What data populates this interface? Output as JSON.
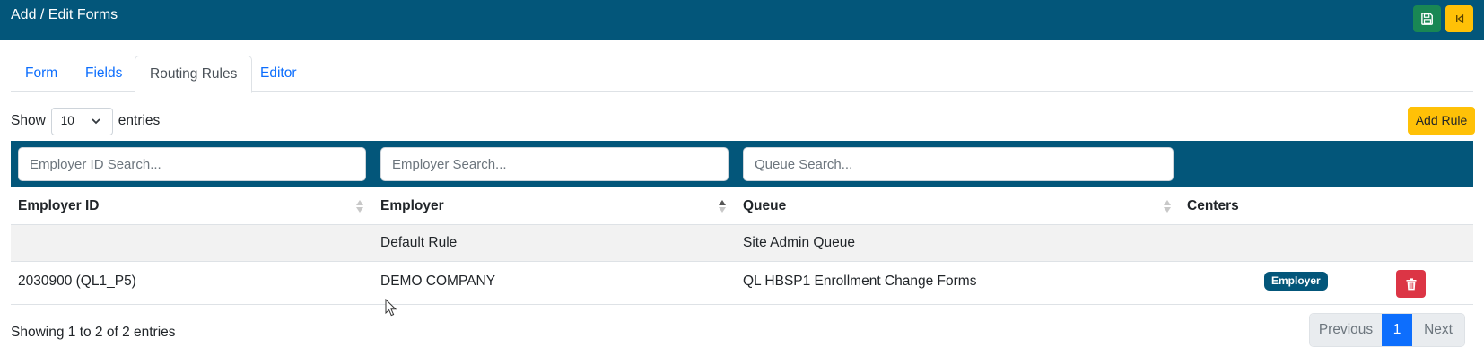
{
  "header": {
    "title": "Add / Edit Forms",
    "save_icon": "save-icon",
    "back_icon": "back-to-start-icon",
    "bar_color": "#03567a"
  },
  "tabs": [
    {
      "label": "Form",
      "active": false
    },
    {
      "label": "Fields",
      "active": false
    },
    {
      "label": "Routing Rules",
      "active": true
    },
    {
      "label": "Editor",
      "active": false
    }
  ],
  "length_control": {
    "prefix": "Show",
    "value": "10",
    "suffix": "entries"
  },
  "add_rule_label": "Add Rule",
  "search": {
    "employer_id_placeholder": "Employer ID Search...",
    "employer_placeholder": "Employer Search...",
    "queue_placeholder": "Queue Search..."
  },
  "table": {
    "columns": [
      "Employer ID",
      "Employer",
      "Queue",
      "Centers"
    ],
    "rows": [
      {
        "employer_id": "",
        "employer": "Default Rule",
        "queue": "Site Admin Queue",
        "centers": ""
      },
      {
        "employer_id": "2030900 (QL1_P5)",
        "employer": "DEMO COMPANY",
        "queue": "QL HBSP1 Enrollment Change Forms",
        "centers": "Employer"
      }
    ]
  },
  "info_text": "Showing 1 to 2 of 2 entries",
  "pagination": {
    "previous": "Previous",
    "current": "1",
    "next": "Next"
  },
  "colors": {
    "primary": "#0d6efd",
    "success": "#198754",
    "warning": "#ffc107",
    "danger": "#dc3545"
  }
}
